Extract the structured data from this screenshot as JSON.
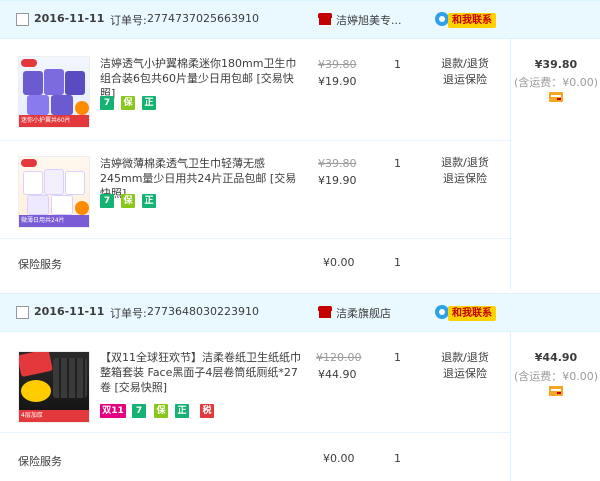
{
  "currency": "¥",
  "colors": {
    "header_bg": "#eaf8ff",
    "border": "#daf3ff",
    "contact_bg": "#ffd100",
    "contact_text": "#c40000",
    "shop_icon": "#c40000"
  },
  "orders": [
    {
      "date": "2016-11-11",
      "order_no_label": "订单号:",
      "order_no": "2774737025663910",
      "shop_name": "洁婷旭美专...",
      "shop_icon": "tmall-shop-icon",
      "contact_label": "和我联系",
      "items": [
        {
          "title": "洁婷透气小护翼棉柔迷你180mm卫生巾组合装6包共60片量少日用包邮 [交易快照]",
          "thumb_caption": "迷你小护翼共60片",
          "price_original": "¥39.80",
          "price_current": "¥19.90",
          "quantity": "1",
          "service_refund": "退款/退货",
          "service_warranty": "退运保险",
          "badges": [
            "7",
            "保",
            "正"
          ]
        },
        {
          "title": "洁婷微薄棉柔透气卫生巾轻薄无感245mm量少日用共24片正品包邮 [交易快照]",
          "thumb_caption": "微薄日用共24片",
          "price_original": "¥39.80",
          "price_current": "¥19.90",
          "quantity": "1",
          "service_refund": "退款/退货",
          "service_warranty": "退运保险",
          "badges": [
            "7",
            "保",
            "正"
          ]
        }
      ],
      "insurance": {
        "label": "保险服务",
        "price": "¥0.00",
        "quantity": "1"
      },
      "total": "¥39.80",
      "shipping": "(含运费：¥0.00)"
    },
    {
      "date": "2016-11-11",
      "order_no_label": "订单号:",
      "order_no": "2773648030223910",
      "shop_name": "洁柔旗舰店",
      "shop_icon": "tmall-shop-icon",
      "contact_label": "和我联系",
      "items": [
        {
          "title": "【双11全球狂欢节】洁柔卷纸卫生纸纸巾整箱套装 Face黑面子4层卷筒纸厕纸*27卷 [交易快照]",
          "thumb_caption": "4层加厚",
          "price_original": "¥120.00",
          "price_current": "¥44.90",
          "quantity": "1",
          "service_refund": "退款/退货",
          "service_warranty": "退运保险",
          "badges": [
            "双11",
            "7",
            "保",
            "正",
            "税"
          ]
        }
      ],
      "insurance": {
        "label": "保险服务",
        "price": "¥0.00",
        "quantity": "1"
      },
      "total": "¥44.90",
      "shipping": "(含运费：¥0.00)"
    }
  ]
}
